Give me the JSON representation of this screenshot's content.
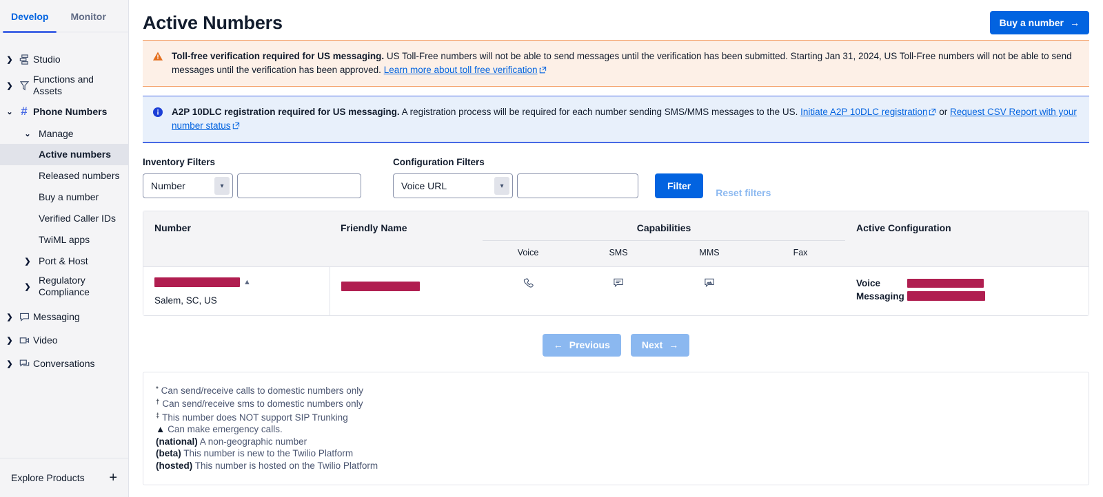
{
  "sidebar": {
    "tabs": [
      {
        "label": "Develop",
        "active": true
      },
      {
        "label": "Monitor",
        "active": false
      }
    ],
    "items": [
      {
        "label": "Studio",
        "icon": "studio-icon"
      },
      {
        "label": "Functions and Assets",
        "icon": "functions-icon"
      },
      {
        "label": "Phone Numbers",
        "icon": "hash-icon"
      },
      {
        "label": "Manage"
      },
      {
        "label": "Active numbers"
      },
      {
        "label": "Released numbers"
      },
      {
        "label": "Buy a number"
      },
      {
        "label": "Verified Caller IDs"
      },
      {
        "label": "TwiML apps"
      },
      {
        "label": "Port & Host"
      },
      {
        "label": "Regulatory Compliance"
      },
      {
        "label": "Messaging",
        "icon": "chat-icon"
      },
      {
        "label": "Video",
        "icon": "video-icon"
      },
      {
        "label": "Conversations",
        "icon": "conversations-icon"
      }
    ],
    "explore_label": "Explore Products"
  },
  "header": {
    "title": "Active Numbers",
    "buy_button": "Buy a number"
  },
  "alerts": {
    "warning": {
      "icon": "warning-triangle-icon",
      "bold": "Toll-free verification required for US messaging.",
      "text": " US Toll-Free numbers will not be able to send messages until the verification has been submitted. Starting Jan 31, 2024, US Toll-Free numbers will not be able to send messages until the verification has been approved. ",
      "link": "Learn more about toll free verification"
    },
    "info": {
      "icon": "info-circle-icon",
      "bold": "A2P 10DLC registration required for US messaging.",
      "text": " A registration process will be required for each number sending SMS/MMS messages to the US. ",
      "link1": "Initiate A2P 10DLC registration",
      "between": " or ",
      "link2": "Request CSV Report with your number status"
    }
  },
  "filters": {
    "inventory_label": "Inventory Filters",
    "inventory_select": "Number",
    "inventory_value": "",
    "inventory_placeholder": "",
    "configuration_label": "Configuration Filters",
    "configuration_select": "Voice URL",
    "configuration_value": "",
    "configuration_placeholder": "",
    "filter_button": "Filter",
    "reset_button": "Reset filters"
  },
  "table": {
    "columns": {
      "number": "Number",
      "friendly_name": "Friendly Name",
      "capabilities": "Capabilities",
      "active_configuration": "Active Configuration"
    },
    "capability_columns": [
      "Voice",
      "SMS",
      "MMS",
      "Fax"
    ],
    "rows": [
      {
        "number": "[redacted]",
        "number_badge": "▲",
        "location": "Salem, SC, US",
        "friendly_name": "[redacted]",
        "voice": "phone-icon",
        "sms": "sms-bubble-icon",
        "mms": "mms-image-icon",
        "fax": "",
        "config": [
          {
            "key": "Voice",
            "value": "[redacted]"
          },
          {
            "key": "Messaging",
            "value": "[redacted]"
          }
        ]
      }
    ]
  },
  "pagination": {
    "previous": "Previous",
    "next": "Next"
  },
  "legend": [
    {
      "mark": "*",
      "sup": true,
      "text": " Can send/receive calls to domestic numbers only"
    },
    {
      "mark": "†",
      "sup": true,
      "text": " Can send/receive sms to domestic numbers only"
    },
    {
      "mark": "‡",
      "sup": true,
      "text": " This number does NOT support SIP Trunking"
    },
    {
      "mark": "▲",
      "sup": false,
      "text": " Can make emergency calls."
    },
    {
      "mark": "(national)",
      "sup": false,
      "text": " A non-geographic number"
    },
    {
      "mark": "(beta)",
      "sup": false,
      "text": " This number is new to the Twilio Platform"
    },
    {
      "mark": "(hosted)",
      "sup": false,
      "text": " This number is hosted on the Twilio Platform"
    }
  ],
  "colors": {
    "accent": "#0263e0",
    "tab_active": "#4769e5",
    "warning_bg": "#fdf0e7",
    "warning_border": "#f4a26b",
    "warning_icon": "#e46f1e",
    "info_bg": "#e8f0fb",
    "info_border": "#4769e5",
    "redaction": "#b01e50",
    "pager": "#8bb8f0"
  }
}
